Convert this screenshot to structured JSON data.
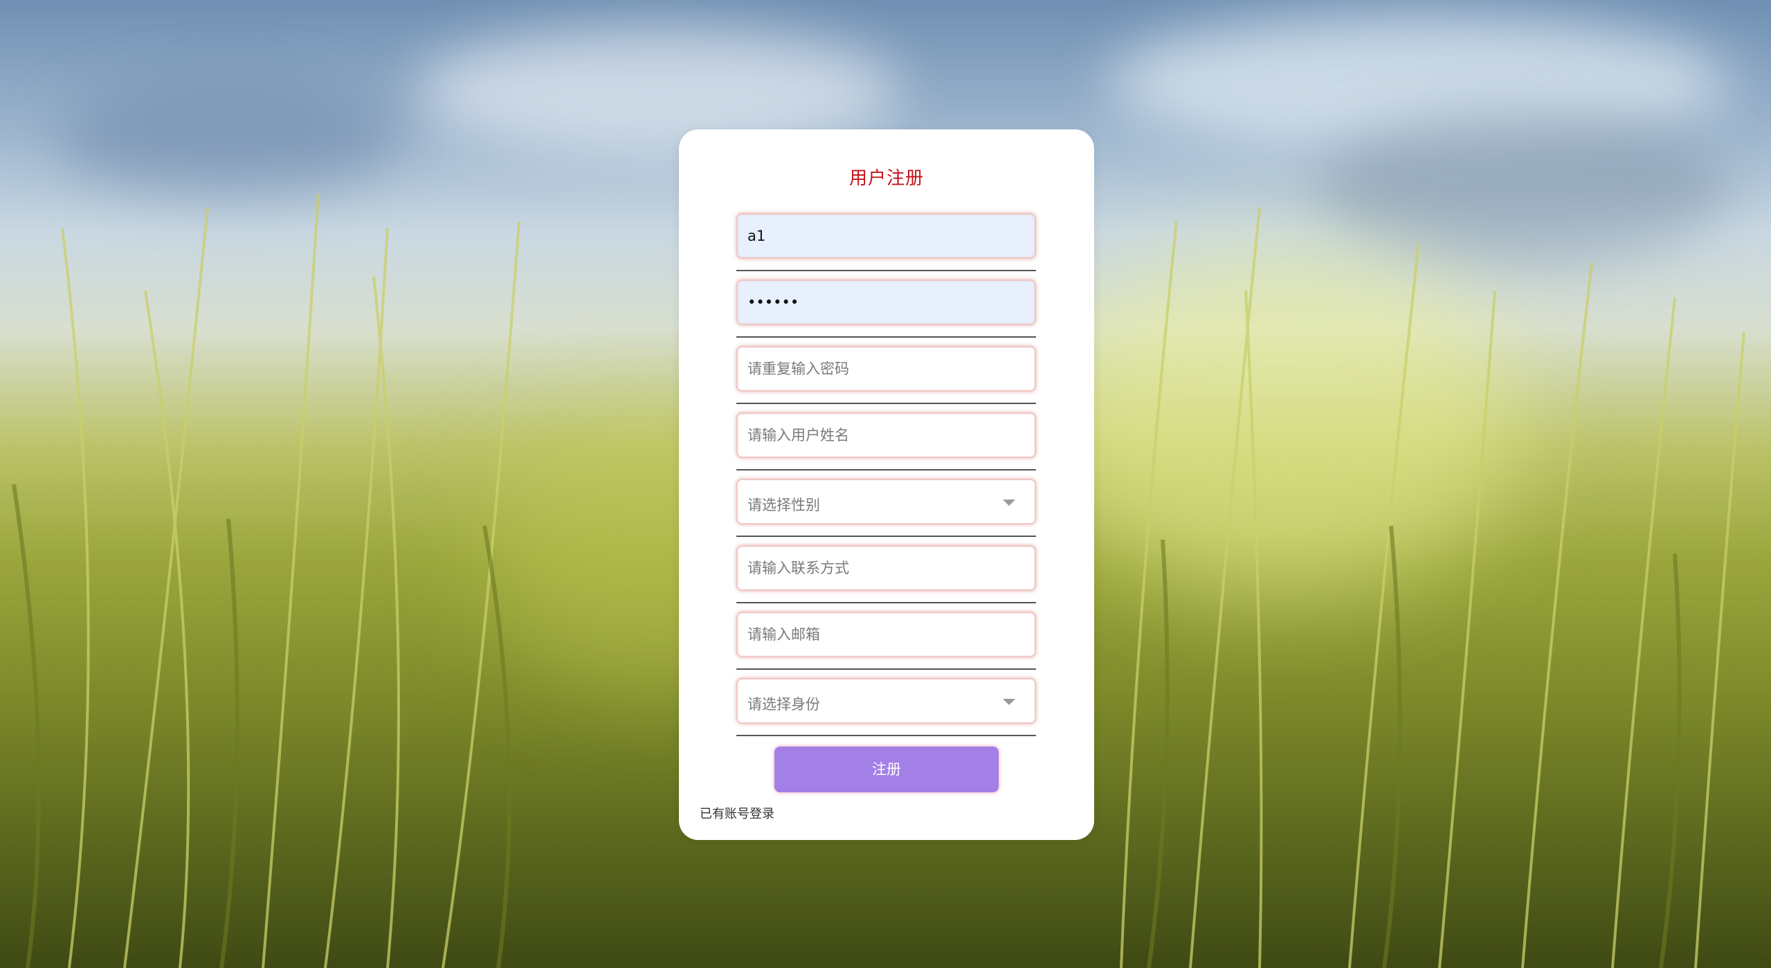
{
  "form": {
    "title": "用户注册",
    "username_value": "a1",
    "password_value": "123456",
    "confirm_password_placeholder": "请重复输入密码",
    "name_placeholder": "请输入用户姓名",
    "gender_placeholder": "请选择性别",
    "contact_placeholder": "请输入联系方式",
    "email_placeholder": "请输入邮箱",
    "role_placeholder": "请选择身份",
    "submit_label": "注册",
    "login_link": "已有账号登录"
  },
  "colors": {
    "title": "#c4121a",
    "submit_bg": "#a37fe8",
    "autofill_bg": "#e8f0fe",
    "field_glow": "#e29696"
  },
  "icons": {
    "dropdown": "chevron-down-icon"
  }
}
